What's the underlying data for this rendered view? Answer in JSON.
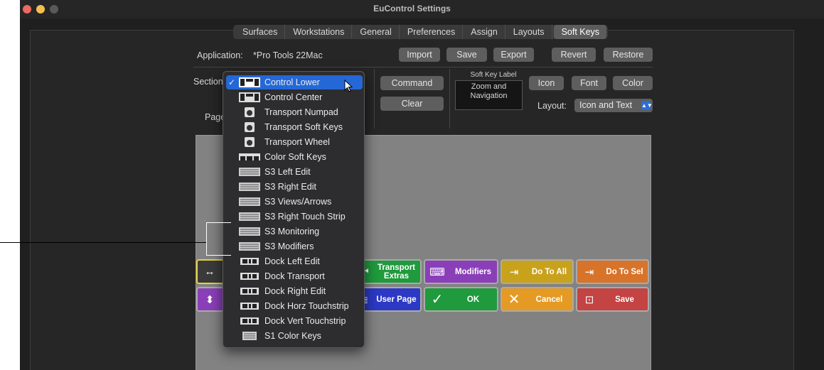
{
  "window": {
    "title": "EuControl Settings"
  },
  "tabs": [
    "Surfaces",
    "Workstations",
    "General",
    "Preferences",
    "Assign",
    "Layouts",
    "Soft Keys"
  ],
  "application": {
    "label": "Application:",
    "value": "*Pro Tools 22Mac",
    "buttons": {
      "import": "Import",
      "save": "Save",
      "export": "Export",
      "revert": "Revert",
      "restore": "Restore"
    }
  },
  "section": {
    "label": "Section",
    "page_label": "Page"
  },
  "actions": {
    "command": "Command",
    "clear": "Clear"
  },
  "soft_key_label": {
    "title": "Soft Key Label",
    "line1": "Zoom and",
    "line2": "Navigation"
  },
  "appearance": {
    "icon": "Icon",
    "font": "Font",
    "color": "Color",
    "layout_label": "Layout:",
    "layout_value": "Icon and Text"
  },
  "section_menu": {
    "selected_check": "✓",
    "items": [
      {
        "label": "Control Lower",
        "icon": "control-lower-icon"
      },
      {
        "label": "Control Center",
        "icon": "control-center-icon"
      },
      {
        "label": "Transport Numpad",
        "icon": "transport-numpad-icon"
      },
      {
        "label": "Transport Soft Keys",
        "icon": "transport-softkeys-icon"
      },
      {
        "label": "Transport Wheel",
        "icon": "transport-wheel-icon"
      },
      {
        "label": "Color Soft Keys",
        "icon": "color-softkeys-icon"
      },
      {
        "label": "S3 Left Edit",
        "icon": "s3-left-edit-icon"
      },
      {
        "label": "S3 Right Edit",
        "icon": "s3-right-edit-icon"
      },
      {
        "label": "S3 Views/Arrows",
        "icon": "s3-views-arrows-icon"
      },
      {
        "label": "S3 Right Touch Strip",
        "icon": "s3-right-touch-strip-icon"
      },
      {
        "label": "S3 Monitoring",
        "icon": "s3-monitoring-icon"
      },
      {
        "label": "S3 Modifiers",
        "icon": "s3-modifiers-icon"
      },
      {
        "label": "Dock Left Edit",
        "icon": "dock-left-edit-icon"
      },
      {
        "label": "Dock Transport",
        "icon": "dock-transport-icon"
      },
      {
        "label": "Dock Right Edit",
        "icon": "dock-right-edit-icon"
      },
      {
        "label": "Dock Horz Touchstrip",
        "icon": "dock-horz-touchstrip-icon"
      },
      {
        "label": "Dock Vert Touchstrip",
        "icon": "dock-vert-touchstrip-icon"
      },
      {
        "label": "S1 Color Keys",
        "icon": "s1-color-keys-icon"
      }
    ]
  },
  "soft_keys": {
    "row1": [
      {
        "label": "",
        "icon": "move-arrows-icon",
        "color": "#3a3a3a",
        "border": "#e8d23a"
      },
      {
        "label": "Transport Extras",
        "icon": "transport-icon",
        "color": "#1f9a3c"
      },
      {
        "label": "Modifiers",
        "icon": "keyboard-icon",
        "color": "#8a3fb8"
      },
      {
        "label": "Do To All",
        "icon": "do-to-all-icon",
        "color": "#c9a21c"
      },
      {
        "label": "Do To Sel",
        "icon": "do-to-sel-icon",
        "color": "#d8732a"
      }
    ],
    "row2": [
      {
        "label": "",
        "icon": "zoom-icon",
        "color": "#8a3fb8"
      },
      {
        "label": "User Page",
        "icon": "list-icon",
        "color": "#2c39c4"
      },
      {
        "label": "OK",
        "icon": "check-icon",
        "color": "#1f9a3c"
      },
      {
        "label": "Cancel",
        "icon": "x-icon",
        "color": "#e59a23"
      },
      {
        "label": "Save",
        "icon": "save-icon",
        "color": "#c44343"
      }
    ]
  }
}
